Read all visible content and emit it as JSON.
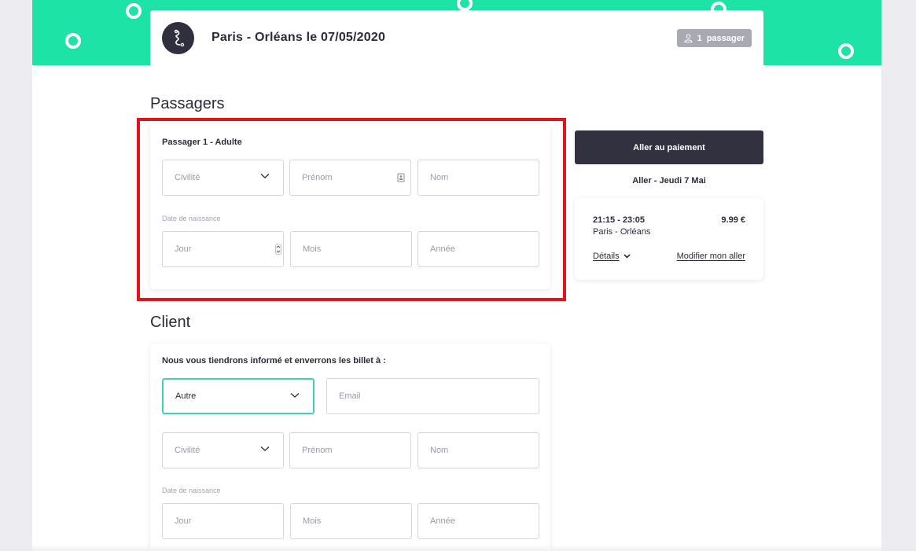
{
  "header": {
    "route_title": "Paris - Orléans le 07/05/2020",
    "passenger_count": "1",
    "passenger_label": "passager"
  },
  "passengers": {
    "section_title": "Passagers",
    "card_title": "Passager 1 - Adulte",
    "civility_placeholder": "Civilité",
    "firstname_placeholder": "Prénom",
    "lastname_placeholder": "Nom",
    "birthdate_label": "Date de naissance",
    "day_placeholder": "Jour",
    "month_placeholder": "Mois",
    "year_placeholder": "Année"
  },
  "client": {
    "section_title": "Client",
    "card_title": "Nous vous tiendrons informé et enverrons les billet à :",
    "recipient_value": "Autre",
    "email_placeholder": "Email",
    "civility_placeholder": "Civilité",
    "firstname_placeholder": "Prénom",
    "lastname_placeholder": "Nom",
    "birthdate_label": "Date de naissance",
    "day_placeholder": "Jour",
    "month_placeholder": "Mois",
    "year_placeholder": "Année"
  },
  "summary": {
    "pay_button": "Aller au paiement",
    "outbound_heading": "Aller - Jeudi 7 Mai",
    "time_range": "21:15 - 23:05",
    "route": "Paris - Orléans",
    "price": "9.99 €",
    "details_link": "Détails",
    "modify_link": "Modifier mon aller"
  },
  "colors": {
    "brand_green": "#1de3a6",
    "dark": "#31313f",
    "highlight_red": "#e2141b",
    "active_border": "#3fd6ad"
  },
  "icons": {
    "logo": "brand-logo-icon",
    "passenger": "user-icon",
    "dropdown": "chevron-down-icon",
    "autofill": "contact-card-icon",
    "spinner": "spinner-arrows-icon"
  }
}
